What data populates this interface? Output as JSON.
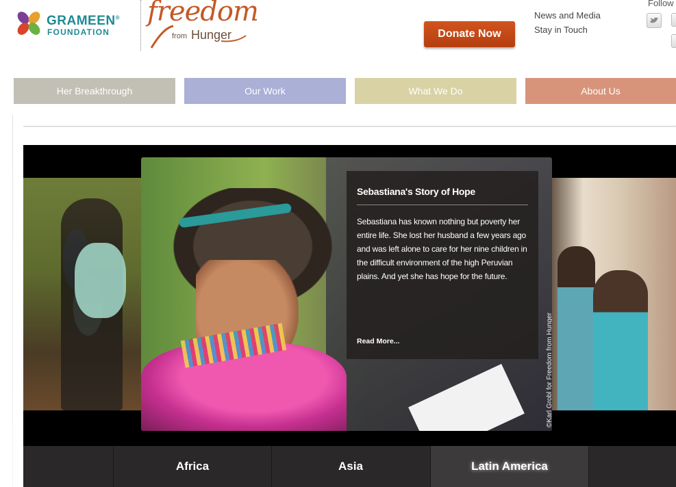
{
  "header": {
    "grameen_logo": {
      "name": "GRAMEEN",
      "sub": "FOUNDATION",
      "reg": "®"
    },
    "ffh_logo": {
      "script": "freedom",
      "from": "from",
      "hunger": "Hunger"
    },
    "donate_label": "Donate Now",
    "links": [
      "News and Media",
      "Stay in Touch"
    ],
    "follow_label": "Follow",
    "social_icons": [
      "twitter-icon",
      "social-icon-2",
      "social-icon-3"
    ]
  },
  "nav": {
    "items": [
      {
        "label": "Her Breakthrough",
        "color": "#c2c0b5"
      },
      {
        "label": "Our Work",
        "color": "#aab0d6"
      },
      {
        "label": "What We Do",
        "color": "#d9d2a5"
      },
      {
        "label": "About Us",
        "color": "#d8947a"
      }
    ]
  },
  "slider": {
    "caption": {
      "title": "Sebastiana's Story of Hope",
      "body": "Sebastiana has known nothing but poverty her entire life. She lost her husband a few years ago and was left alone to care for her nine children in the difficult environment of the high Peruvian plains. And yet she has hope for the future.",
      "read_more": "Read More..."
    },
    "photo_credit": "©Karl Grobl for Freedom from Hunger",
    "tabs": [
      {
        "label": "Africa"
      },
      {
        "label": "Asia"
      },
      {
        "label": "Latin America",
        "selected": true
      }
    ]
  },
  "colors": {
    "brand_teal": "#1f8a93",
    "brand_orange": "#c35a26",
    "donate": "#c4471a"
  }
}
